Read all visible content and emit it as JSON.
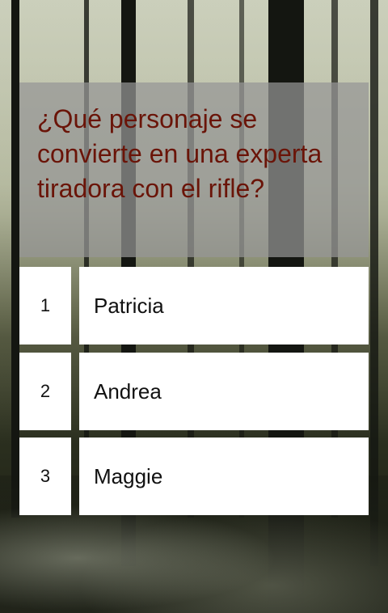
{
  "question": {
    "text": "¿Qué personaje se convierte en una experta tiradora con el rifle?"
  },
  "answers": [
    {
      "number": "1",
      "label": "Patricia"
    },
    {
      "number": "2",
      "label": "Andrea"
    },
    {
      "number": "3",
      "label": "Maggie"
    }
  ],
  "colors": {
    "question_text": "#6a1408",
    "question_box": "rgba(150,150,150,0.72)",
    "answer_bg": "#ffffff"
  }
}
